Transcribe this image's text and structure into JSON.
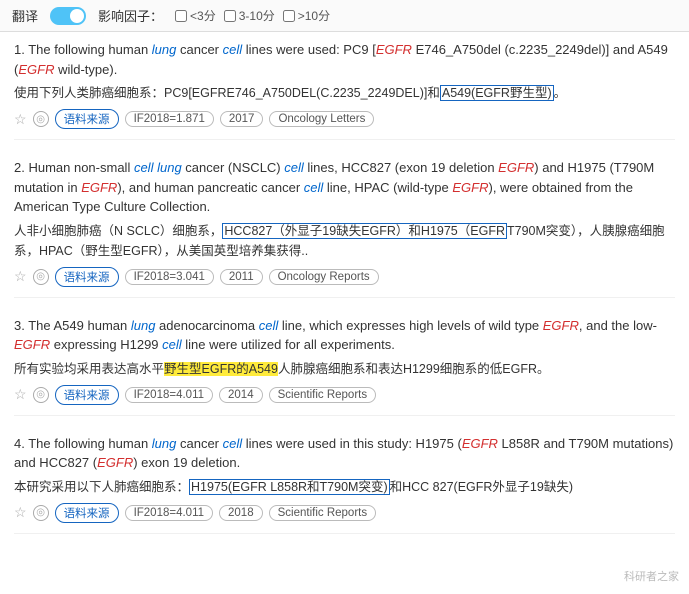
{
  "header": {
    "translate_label": "翻译",
    "influence_label": "影响因子：",
    "filter1": "<3分",
    "filter2": "3-10分",
    "filter3": ">10分"
  },
  "results": [
    {
      "num": "1.",
      "en_parts": [
        {
          "text": "The following human "
        },
        {
          "text": "lung",
          "italic": true,
          "color": "blue"
        },
        {
          "text": " cancer "
        },
        {
          "text": "cell",
          "italic": true,
          "color": "blue"
        },
        {
          "text": " lines were used: PC9 ["
        },
        {
          "text": "EGFR",
          "italic": true,
          "color": "red"
        },
        {
          "text": " E746_A750del (c.2235_2249del)] and A549 ("
        },
        {
          "text": "EGFR",
          "italic": true,
          "color": "red"
        },
        {
          "text": " wild-type)."
        }
      ],
      "cn_text": "使用下列人类肺癌细胞系：PC9[EGFRE746_A750DEL(C.2235_2249DEL)]和",
      "cn_highlighted": "A549(EGFR野生型)。",
      "cn_highlight_type": "blue-border",
      "year": "2017",
      "if_val": "IF2018=1.871",
      "journal": "Oncology Letters",
      "source_label": "语料来源"
    },
    {
      "num": "2.",
      "en_parts": [
        {
          "text": "Human non-small "
        },
        {
          "text": "cell",
          "italic": true,
          "color": "blue"
        },
        {
          "text": " lung cancer (NSCLC) "
        },
        {
          "text": "cell",
          "italic": true,
          "color": "blue"
        },
        {
          "text": " lines, HCC827 (exon 19 deletion "
        },
        {
          "text": "EGF",
          "italic": true,
          "color": "red"
        },
        {
          "text": "R) and H1975 (T790M mutation in "
        },
        {
          "text": "EGFR",
          "italic": true,
          "color": "red"
        },
        {
          "text": "), and human pancreatic cancer "
        },
        {
          "text": "cell",
          "italic": true,
          "color": "blue"
        },
        {
          "text": " line, HPAC (wild-type "
        },
        {
          "text": "EGFR",
          "italic": true,
          "color": "red"
        },
        {
          "text": "), were obtained from the American Type Culture Collection."
        }
      ],
      "cn_text": "人非小细胞肺癌（N SCLC）细胞系，",
      "cn_highlighted": "HCC827（外显子19缺失EGFR）和H1975（EGFR",
      "cn_highlight_type": "blue-border",
      "cn_text2": "T790M突变），人胰腺癌细胞系，HPAC（野生型EGFR），从美国英型培养集获得..",
      "year": "2011",
      "if_val": "IF2018=3.041",
      "journal": "Oncology Reports",
      "source_label": "语料来源"
    },
    {
      "num": "3.",
      "en_parts": [
        {
          "text": "The A549 human "
        },
        {
          "text": "lung",
          "italic": true,
          "color": "blue"
        },
        {
          "text": " adenocarcinoma "
        },
        {
          "text": "cell",
          "italic": true,
          "color": "blue"
        },
        {
          "text": " line, which expresses high levels of wild type "
        },
        {
          "text": "EGFR",
          "italic": true,
          "color": "red"
        },
        {
          "text": ", and the low-"
        },
        {
          "text": "EGFR",
          "italic": true,
          "color": "red"
        },
        {
          "text": " expressing H1299 "
        },
        {
          "text": "cell",
          "italic": true,
          "color": "blue"
        },
        {
          "text": " line were utilized for all experiments."
        }
      ],
      "cn_text": "所有实验均采用表达高水平",
      "cn_highlighted": "野生型EGFR的A549",
      "cn_highlight_type": "yellow",
      "cn_text2": "人肺腺癌细胞系和表达H1299细胞系的低EGFR。",
      "year": "2014",
      "if_val": "IF2018=4.011",
      "journal": "Scientific Reports",
      "source_label": "语料来源"
    },
    {
      "num": "4.",
      "en_parts": [
        {
          "text": "The following human "
        },
        {
          "text": "lung",
          "italic": true,
          "color": "blue"
        },
        {
          "text": " cancer "
        },
        {
          "text": "cell",
          "italic": true,
          "color": "blue"
        },
        {
          "text": " lines were used in this study: H1975 ("
        },
        {
          "text": "EGFR",
          "italic": true,
          "color": "red"
        },
        {
          "text": " L858R and T790M mutations) and HCC827 ("
        },
        {
          "text": "EGFR",
          "italic": true,
          "color": "red"
        },
        {
          "text": ") exon 19 deletion."
        }
      ],
      "cn_text": "本研究采用以下人肺癌细胞系：",
      "cn_highlighted": "H1975(EGFR L858R和T790M突变)",
      "cn_highlight_type": "blue-border",
      "cn_text2": "和HCC 827(EGFR外显子19缺失)",
      "year": "2018",
      "if_val": "IF2018=4.011",
      "journal": "Scientific Reports",
      "source_label": "语料来源"
    }
  ],
  "watermark": "科研者之家"
}
